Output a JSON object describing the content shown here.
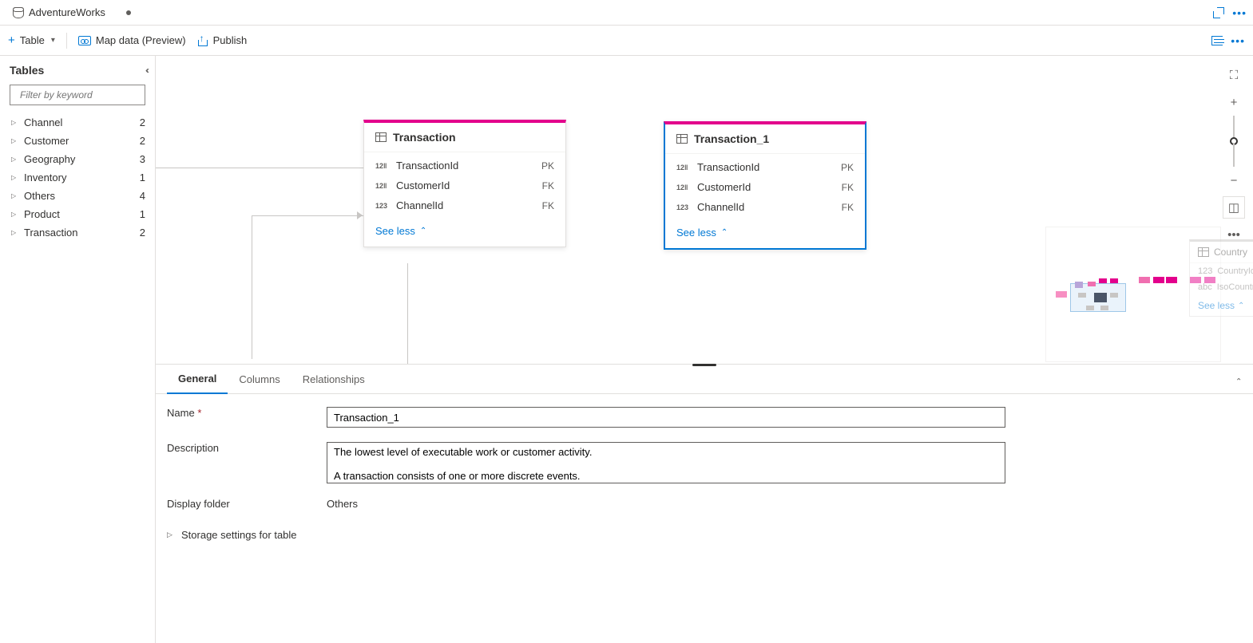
{
  "tabBar": {
    "title": "AdventureWorks"
  },
  "toolbar": {
    "table_label": "Table",
    "mapdata_label": "Map data (Preview)",
    "publish_label": "Publish"
  },
  "sidebar": {
    "title": "Tables",
    "filter_placeholder": "Filter by keyword",
    "items": [
      {
        "label": "Channel",
        "count": "2"
      },
      {
        "label": "Customer",
        "count": "2"
      },
      {
        "label": "Geography",
        "count": "3"
      },
      {
        "label": "Inventory",
        "count": "1"
      },
      {
        "label": "Others",
        "count": "4"
      },
      {
        "label": "Product",
        "count": "1"
      },
      {
        "label": "Transaction",
        "count": "2"
      }
    ]
  },
  "canvas": {
    "tables": [
      {
        "name": "Transaction",
        "columns": [
          {
            "type": "12‖",
            "name": "TransactionId",
            "key": "PK"
          },
          {
            "type": "12‖",
            "name": "CustomerId",
            "key": "FK"
          },
          {
            "type": "123",
            "name": "ChannelId",
            "key": "FK"
          }
        ],
        "footer": "See less"
      },
      {
        "name": "Transaction_1",
        "columns": [
          {
            "type": "12‖",
            "name": "TransactionId",
            "key": "PK"
          },
          {
            "type": "12‖",
            "name": "CustomerId",
            "key": "FK"
          },
          {
            "type": "123",
            "name": "ChannelId",
            "key": "FK"
          }
        ],
        "footer": "See less"
      }
    ],
    "ghost": {
      "name": "Country",
      "rows": [
        {
          "type": "123",
          "name": "CountryId"
        },
        {
          "type": "abc",
          "name": "IsoCountr"
        }
      ],
      "footer": "See less"
    }
  },
  "propertyTabs": {
    "general": "General",
    "columns": "Columns",
    "relationships": "Relationships"
  },
  "form": {
    "name_label": "Name",
    "name_value": "Transaction_1",
    "desc_label": "Description",
    "desc_value": "The lowest level of executable work or customer activity.\n\nA transaction consists of one or more discrete events.",
    "display_folder_label": "Display folder",
    "display_folder_value": "Others",
    "storage_label": "Storage settings for table"
  }
}
